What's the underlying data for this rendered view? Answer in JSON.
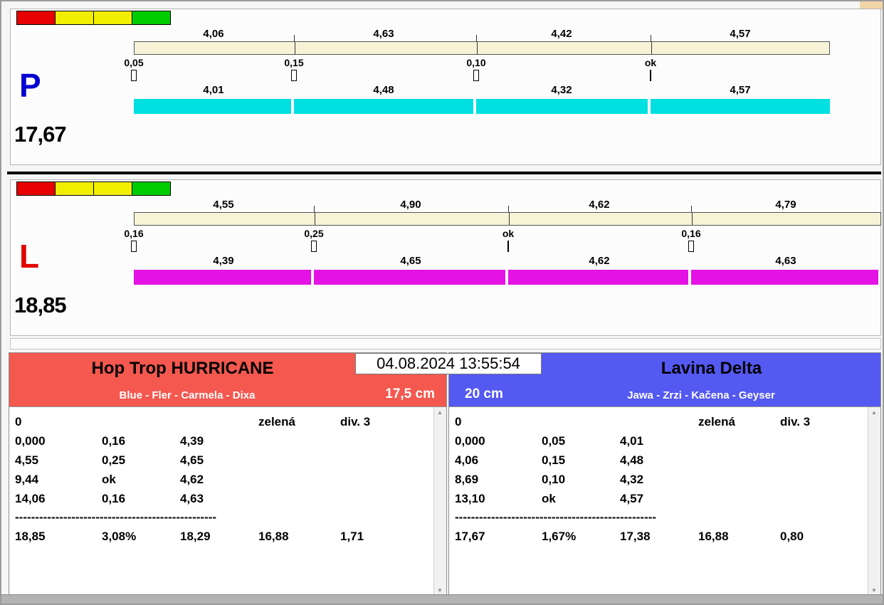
{
  "chrome": {
    "timestamp": "04.08.2024 13:55:54"
  },
  "lane_p": {
    "letter": "P",
    "letter_color": "#0000d2",
    "total": "17,67",
    "lights": [
      "#e60000",
      "#f2ee00",
      "#f2ee00",
      "#00cc00"
    ],
    "top_splits": [
      "4,06",
      "4,63",
      "4,42",
      "4,57"
    ],
    "reactions": [
      "0,05",
      "0,15",
      "0,10",
      "ok"
    ],
    "run_splits": [
      "4,01",
      "4,48",
      "4,32",
      "4,57"
    ],
    "bar_color": "#00e0e0"
  },
  "lane_l": {
    "letter": "L",
    "letter_color": "#e00000",
    "total": "18,85",
    "lights": [
      "#e60000",
      "#f2ee00",
      "#f2ee00",
      "#00cc00"
    ],
    "top_splits": [
      "4,55",
      "4,90",
      "4,62",
      "4,79"
    ],
    "reactions": [
      "0,16",
      "0,25",
      "ok",
      "0,16"
    ],
    "run_splits": [
      "4,39",
      "4,65",
      "4,62",
      "4,63"
    ],
    "bar_color": "#e412e4"
  },
  "team_left": {
    "name": "Hop Trop HURRICANE",
    "dogs": "Blue - Fler - Carmela - Dixa",
    "jump_height": "17,5 cm",
    "header_color": "#f4584f",
    "status_flag": "0",
    "status_color": "zelená",
    "division": "div. 3",
    "rows": [
      [
        "0,000",
        "0,16",
        "4,39"
      ],
      [
        "4,55",
        "0,25",
        "4,65"
      ],
      [
        "9,44",
        "ok",
        "4,62"
      ],
      [
        "14,06",
        "0,16",
        "4,63"
      ]
    ],
    "divider": "--------------------------------------------------",
    "totals": [
      "18,85",
      "3,08%",
      "18,29",
      "16,88",
      "1,71"
    ]
  },
  "team_right": {
    "name": "Lavina Delta",
    "dogs": "Jawa - Zrzi - Kačena - Geyser",
    "jump_height": "20 cm",
    "header_color": "#5459f1",
    "status_flag": "0",
    "status_color": "zelená",
    "division": "div. 3",
    "rows": [
      [
        "0,000",
        "0,05",
        "4,01"
      ],
      [
        "4,06",
        "0,15",
        "4,48"
      ],
      [
        "8,69",
        "0,10",
        "4,32"
      ],
      [
        "13,10",
        "ok",
        "4,57"
      ]
    ],
    "divider": "--------------------------------------------------",
    "totals": [
      "17,67",
      "1,67%",
      "17,38",
      "16,88",
      "0,80"
    ]
  },
  "scrollbar": {
    "up": "▲",
    "down": "▼"
  }
}
